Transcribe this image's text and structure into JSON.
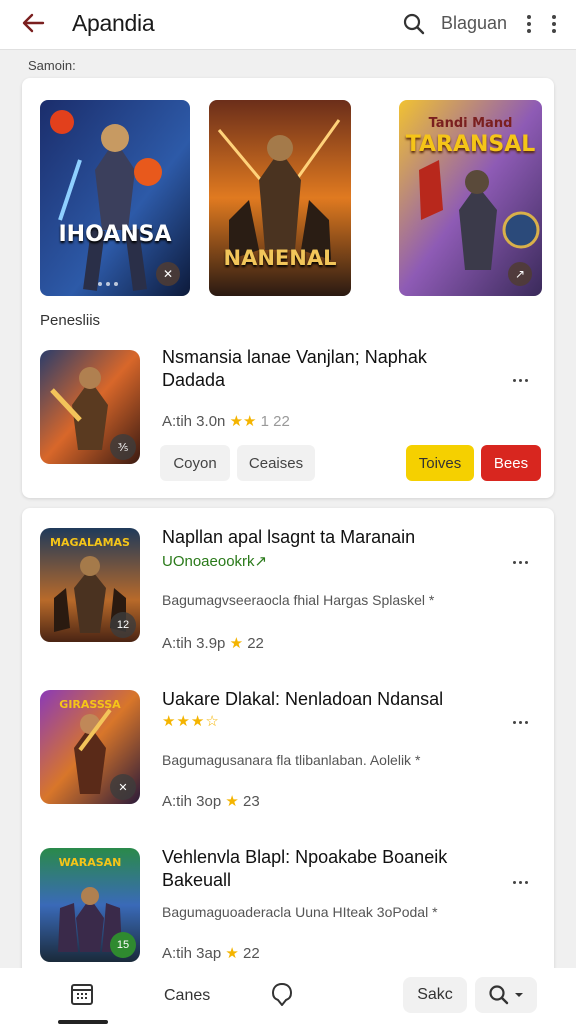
{
  "header": {
    "title": "Apandia",
    "language": "Blaguan",
    "icons": {
      "back": "arrow-left-icon",
      "search": "search-icon",
      "more": "more-vert-icon"
    }
  },
  "section_label": "Samoin:",
  "featured": [
    {
      "title": "IHOANSA",
      "badge": "✕"
    },
    {
      "title": "NANENAL",
      "badge": ""
    },
    {
      "title": "TARANSAL",
      "topline": "Tandi Mand",
      "badge": "↗"
    }
  ],
  "subheading": "Penesliis",
  "top_item": {
    "title_line1": "Nsmansia lanae Vanjlan; Naphak",
    "title_line2": "Dadada",
    "meta": "A:tih  3.0n",
    "meta_stars": "★★",
    "meta_tail": "1 22",
    "thumb_badge": "⅗",
    "chips": [
      "Coyon",
      "Ceaises"
    ],
    "buttons": [
      "Toives",
      "Bees"
    ]
  },
  "list": [
    {
      "title_line1": "Napllan apal lsagnt ta Maranain",
      "subtitle": "UOnoaeookrk↗",
      "banner": "MAGALAMAS",
      "desc": "Bagumagvseeraocla fhial Hargas Splaskel *",
      "meta": "A:tih  3.9p",
      "meta_tail": "22",
      "thumb_badge": "12"
    },
    {
      "title_line1": "Uakare Dlakal: Nenladoan Ndansal",
      "banner": "GIRASSSA",
      "rating_stars": "★★★☆",
      "desc": "Bagumagusanara fla tlibanlaban. Aolelik *",
      "meta": "A:tih  3op",
      "meta_tail": "23",
      "thumb_badge": "✕"
    },
    {
      "title_line1": "Vehlenvla Blapl: Npoakabe Boaneik",
      "title_line2": "Bakeuall",
      "banner": "WARASAN",
      "desc": "Bagumaguoaderacla Uuna HIteak 3oPodal *",
      "meta": "A:tih  3ap",
      "meta_tail": "22",
      "thumb_badge": "15"
    }
  ],
  "bottom_nav": {
    "label_games": "Canes",
    "pill_label": "Sakc",
    "icons": {
      "home": "calendar-grid-icon",
      "chat": "chat-bubble-icon",
      "search": "search-icon",
      "dropdown": "chevron-down-icon"
    }
  },
  "colors": {
    "accent_red": "#d8261f",
    "accent_yellow": "#f5d000",
    "star": "#f4b400",
    "back_arrow": "#7a1f1f"
  }
}
